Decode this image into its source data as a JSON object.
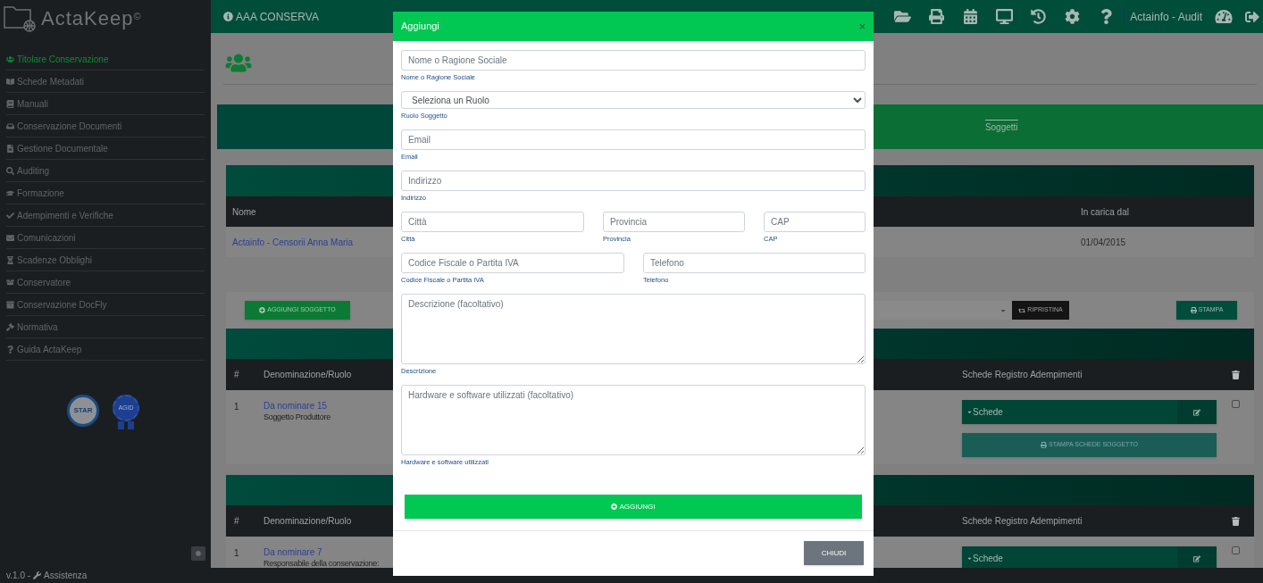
{
  "sidebar": {
    "logo": "ActaKeep",
    "logo_mark": "©",
    "items": [
      {
        "label": "Titolare Conservazione",
        "selected": true
      },
      {
        "label": "Schede Metadati",
        "selected": false
      },
      {
        "label": "Manuali",
        "selected": false
      },
      {
        "label": "Conservazione Documenti",
        "selected": false
      },
      {
        "label": "Gestione Documentale",
        "selected": false
      },
      {
        "label": "Auditing",
        "selected": false
      },
      {
        "label": "Formazione",
        "selected": false
      },
      {
        "label": "Adempimenti e Verifiche",
        "selected": false
      },
      {
        "label": "Comunicazioni",
        "selected": false
      },
      {
        "label": "Scadenze Obblighi",
        "selected": false
      },
      {
        "label": "Conservatore",
        "selected": false
      },
      {
        "label": "Conservazione DocFly",
        "selected": false
      },
      {
        "label": "Normativa",
        "selected": false
      },
      {
        "label": "Guida ActaKeep",
        "selected": false
      }
    ],
    "badges": [
      {
        "label": "STAR"
      },
      {
        "label": "AGID"
      }
    ]
  },
  "footer": {
    "version": "v.1.0 -",
    "support_link": "Assistenza"
  },
  "topbar": {
    "title": "AAA CONSERVA",
    "user": "Actainfo - Audit"
  },
  "tabs": [
    {
      "label": "Soggetti",
      "selected": true
    }
  ],
  "holder_table": {
    "columns": [
      "Nome",
      "In carica dal"
    ],
    "rows": [
      [
        "Actainfo - Censorii Anna Maria",
        "01/04/2015"
      ]
    ]
  },
  "toolbar": {
    "add_button": "AGGIUNGI SOGGETTO",
    "reset_button": "RIPRISTINA",
    "print_button": "STAMPA"
  },
  "subject_groups": [
    {
      "columns": [
        "#",
        "Denominazione/Ruolo",
        "Schede Registro Adempimenti"
      ],
      "rows": [
        {
          "index": "1",
          "name": "Da nominare 15",
          "role": "Soggetto Produttore",
          "schede": "Schede",
          "checked": false,
          "print_button": "STAMPA SCHEDE SOGGETTO"
        }
      ]
    },
    {
      "columns": [
        "#",
        "Denominazione/Ruolo",
        "Schede Registro Adempimenti"
      ],
      "rows": [
        {
          "index": "1",
          "name": "Da nominare 7",
          "role": "Responsabile della conservazione:",
          "schede": "Schede",
          "checked": false
        }
      ]
    }
  ],
  "modal": {
    "title": "Aggiungi",
    "close": "×",
    "rows": [
      [
        {
          "kind": "input",
          "placeholder": "Nome o Ragione Sociale",
          "help": "Nome o Ragione Sociale"
        }
      ],
      [
        {
          "kind": "select",
          "value": "Seleziona un Ruolo",
          "help": "Ruolo Soggetto"
        }
      ],
      [
        {
          "kind": "input",
          "placeholder": "Email",
          "help": "Email"
        }
      ],
      [
        {
          "kind": "input",
          "placeholder": "Indirizzo",
          "help": "Indirizzo"
        }
      ],
      [
        {
          "kind": "input",
          "placeholder": "Città",
          "help": "Città"
        },
        {
          "kind": "input",
          "placeholder": "Provincia",
          "help": "Provincia"
        },
        {
          "kind": "input",
          "placeholder": "CAP",
          "help": "CAP"
        }
      ],
      [
        {
          "kind": "input",
          "placeholder": "Codice Fiscale o Partita IVA",
          "help": "Codice Fiscale o Partita IVA"
        },
        {
          "kind": "input",
          "placeholder": "Telefono",
          "help": "Telefono"
        }
      ],
      [
        {
          "kind": "textarea",
          "placeholder": "Descrizione (facoltativo)",
          "help": "Descrizione"
        }
      ],
      [
        {
          "kind": "textarea",
          "placeholder": "Hardware e software utilizzati (facoltativo)",
          "help": "Hardware e software utilizzati"
        }
      ]
    ],
    "submit": "AGGIUNGI",
    "dismiss": "CHIUDI"
  }
}
